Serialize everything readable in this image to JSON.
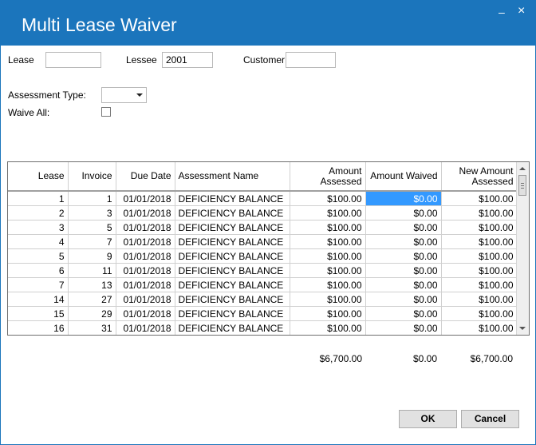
{
  "window": {
    "title": "Multi Lease Waiver",
    "minimize_glyph": "–",
    "close_glyph": "×"
  },
  "filters": {
    "lease_label": "Lease",
    "lease_value": "",
    "lessee_label": "Lessee",
    "lessee_value": "2001",
    "customer_label": "Customer",
    "customer_value": "",
    "assessment_type_label": "Assessment Type:",
    "assessment_type_value": "",
    "waive_all_label": "Waive All:",
    "waive_all_checked": false
  },
  "grid": {
    "columns": [
      "Lease",
      "Invoice",
      "Due Date",
      "Assessment Name",
      "Amount Assessed",
      "Amount Waived",
      "New Amount Assessed"
    ],
    "rows": [
      [
        "1",
        "1",
        "01/01/2018",
        "DEFICIENCY BALANCE",
        "$100.00",
        "$0.00",
        "$100.00"
      ],
      [
        "2",
        "3",
        "01/01/2018",
        "DEFICIENCY BALANCE",
        "$100.00",
        "$0.00",
        "$100.00"
      ],
      [
        "3",
        "5",
        "01/01/2018",
        "DEFICIENCY BALANCE",
        "$100.00",
        "$0.00",
        "$100.00"
      ],
      [
        "4",
        "7",
        "01/01/2018",
        "DEFICIENCY BALANCE",
        "$100.00",
        "$0.00",
        "$100.00"
      ],
      [
        "5",
        "9",
        "01/01/2018",
        "DEFICIENCY BALANCE",
        "$100.00",
        "$0.00",
        "$100.00"
      ],
      [
        "6",
        "11",
        "01/01/2018",
        "DEFICIENCY BALANCE",
        "$100.00",
        "$0.00",
        "$100.00"
      ],
      [
        "7",
        "13",
        "01/01/2018",
        "DEFICIENCY BALANCE",
        "$100.00",
        "$0.00",
        "$100.00"
      ],
      [
        "14",
        "27",
        "01/01/2018",
        "DEFICIENCY BALANCE",
        "$100.00",
        "$0.00",
        "$100.00"
      ],
      [
        "15",
        "29",
        "01/01/2018",
        "DEFICIENCY BALANCE",
        "$100.00",
        "$0.00",
        "$100.00"
      ],
      [
        "16",
        "31",
        "01/01/2018",
        "DEFICIENCY BALANCE",
        "$100.00",
        "$0.00",
        "$100.00"
      ]
    ],
    "selected_cell": {
      "row": 0,
      "col": 5
    }
  },
  "totals": {
    "amount_assessed": "$6,700.00",
    "amount_waived": "$0.00",
    "new_amount_assessed": "$6,700.00"
  },
  "buttons": {
    "ok": "OK",
    "cancel": "Cancel"
  },
  "colors": {
    "titlebar": "#1b75bc",
    "selection": "#3399ff"
  }
}
